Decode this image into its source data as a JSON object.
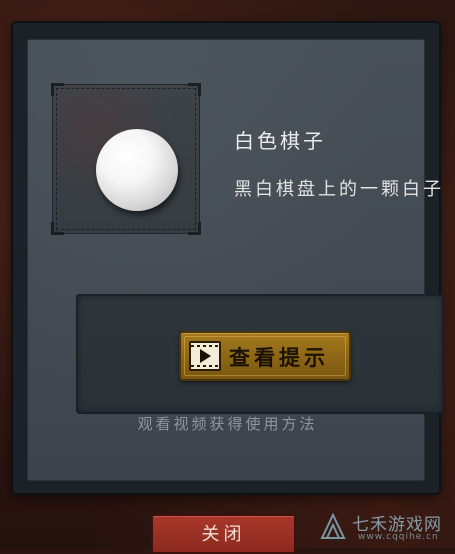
{
  "item": {
    "name": "白色棋子",
    "description": "黑白棋盘上的一颗白子",
    "icon": "white-chess-piece-icon"
  },
  "hint": {
    "button_label": "查看提示",
    "button_icon": "video-play-icon",
    "instruction": "观看视频获得使用方法"
  },
  "dialog": {
    "close_label": "关闭"
  },
  "watermark": {
    "name": "七禾游戏网",
    "url": "www.cqqihe.cn"
  },
  "colors": {
    "panel": "#434a52",
    "hint_button": "#8c6515",
    "close_button": "#8d2a1f"
  }
}
